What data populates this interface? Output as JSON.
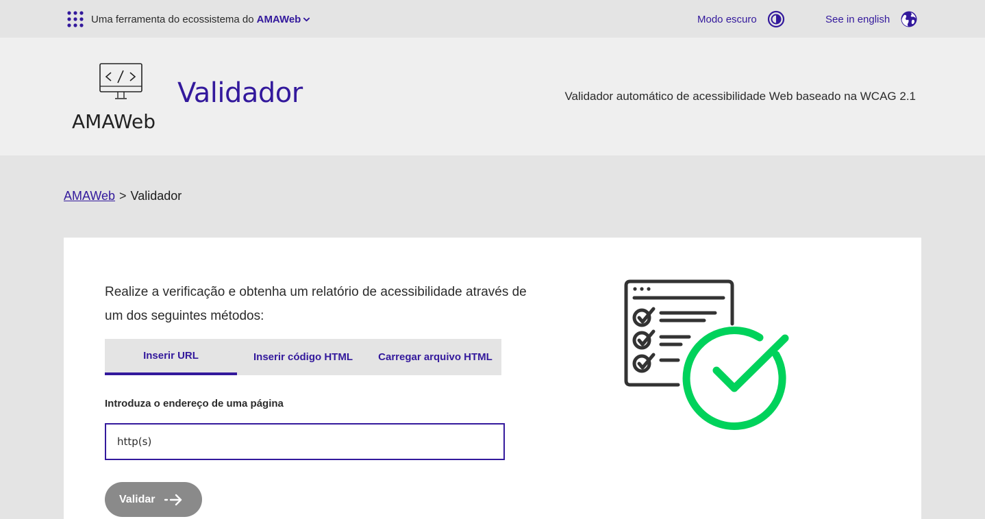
{
  "topbar": {
    "ecosystem_text": "Uma ferramenta do ecossistema do",
    "ecosystem_link": "AMAWeb",
    "dark_mode_label": "Modo escuro",
    "language_label": "See in english"
  },
  "header": {
    "logo_text": "AMAWeb",
    "title": "Validador",
    "tagline": "Validador automático de acessibilidade Web baseado na WCAG 2.1"
  },
  "breadcrumb": {
    "home": "AMAWeb",
    "separator": ">",
    "current": "Validador"
  },
  "main": {
    "intro": "Realize a verificação e obtenha um relatório de acessibilidade através de um dos seguintes métodos:",
    "tabs": [
      {
        "label": "Inserir URL",
        "active": true
      },
      {
        "label": "Inserir código HTML",
        "active": false
      },
      {
        "label": "Carregar arquivo HTML",
        "active": false
      }
    ],
    "field_label": "Introduza o endereço de uma página",
    "url_placeholder": "http(s)",
    "url_value": "",
    "validate_label": "Validar"
  },
  "colors": {
    "accent": "#33199c",
    "check_green": "#00d25b",
    "button_disabled": "#8a8a8a"
  },
  "icons": {
    "ecosystem": "apps-grid-icon",
    "dropdown": "chevron-down-icon",
    "dark_mode": "contrast-icon",
    "language": "globe-icon",
    "submit": "arrow-right-icon",
    "illustration": "checklist-check-illustration"
  }
}
